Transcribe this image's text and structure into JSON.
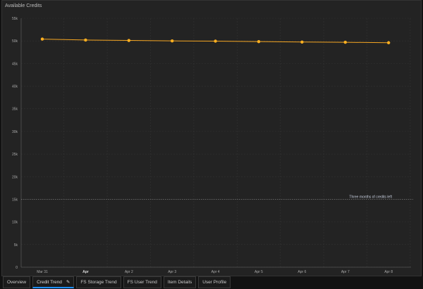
{
  "title": "Available Credits",
  "tabs": [
    {
      "label": "Overview"
    },
    {
      "label": "Credit Trend",
      "active": true
    },
    {
      "label": "FS Storage Trend"
    },
    {
      "label": "FS User Trend"
    },
    {
      "label": "Item Details"
    },
    {
      "label": "User Profile"
    }
  ],
  "chart_data": {
    "type": "line",
    "title": "Available Credits",
    "categories": [
      "Mar 31",
      "Apr",
      "Apr 2",
      "Apr 3",
      "Apr 4",
      "Apr 5",
      "Apr 6",
      "Apr 7",
      "Apr 8"
    ],
    "values": [
      50400,
      50200,
      50100,
      50000,
      49950,
      49850,
      49750,
      49700,
      49600
    ],
    "yticks": [
      "0",
      "5k",
      "10k",
      "15k",
      "20k",
      "25k",
      "30k",
      "35k",
      "40k",
      "45k",
      "50k",
      "55k"
    ],
    "ylim": [
      0,
      55000
    ],
    "threshold": {
      "value": 15000,
      "label": "Three months of credits left"
    },
    "grid": true,
    "colors": {
      "line": "#f5a623",
      "point": "#ffb020"
    }
  }
}
